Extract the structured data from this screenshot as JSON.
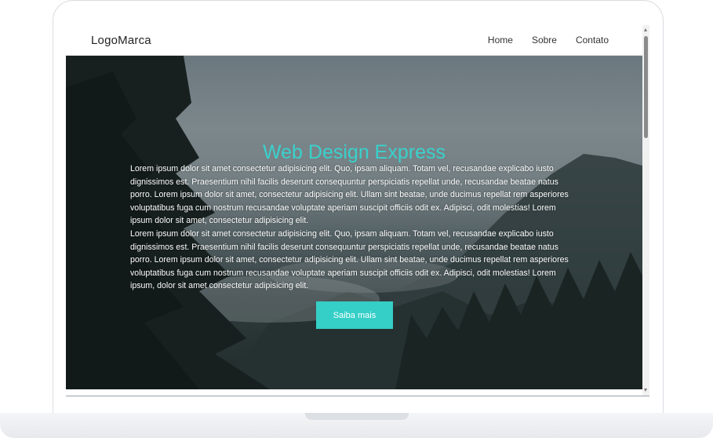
{
  "navbar": {
    "logo": "LogoMarca",
    "links": [
      "Home",
      "Sobre",
      "Contato"
    ]
  },
  "hero": {
    "title": "Web Design Express",
    "paragraph_1": "Lorem ipsum dolor sit amet consectetur adipisicing elit. Quo, ipsam aliquam. Totam vel, recusandae explicabo iusto dignissimos est. Praesentium nihil facilis deserunt consequuntur perspiciatis repellat unde, recusandae beatae natus porro. Lorem ipsum dolor sit amet, consectetur adipisicing elit. Ullam sint beatae, unde ducimus repellat rem asperiores voluptatibus fuga cum nostrum recusandae voluptate aperiam suscipit officiis odit ex. Adipisci, odit molestias! Lorem ipsum dolor sit amet, consectetur adipisicing elit.",
    "paragraph_2": "Lorem ipsum dolor sit amet consectetur adipisicing elit. Quo, ipsam aliquam. Totam vel, recusandae explicabo iusto dignissimos est. Praesentium nihil facilis deserunt consequuntur perspiciatis repellat unde, recusandae beatae natus porro. Lorem ipsum dolor sit amet, consectetur adipisicing elit. Ullam sint beatae, unde ducimus repellat rem asperiores voluptatibus fuga cum nostrum recusandae voluptate aperiam suscipit officiis odit ex. Adipisci, odit molestias! Lorem ipsum, dolor sit amet consectetur adipisicing elit.",
    "button_label": "Saiba mais"
  },
  "colors": {
    "accent": "#35cfc7",
    "title": "#3ad1cc"
  }
}
